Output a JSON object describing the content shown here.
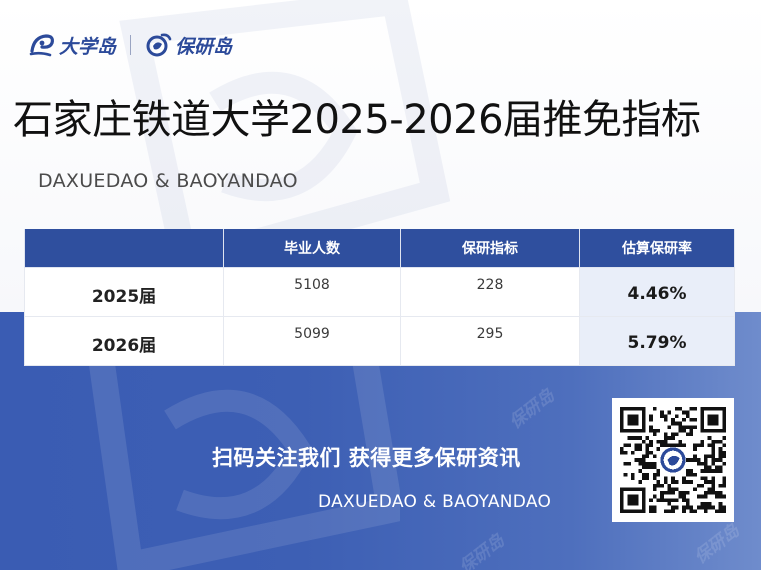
{
  "brand": {
    "logo1_text": "大学岛",
    "logo2_text": "保研岛",
    "brand_color": "#2c4a9a",
    "watermark_text": "保研岛"
  },
  "header": {
    "title": "石家庄铁道大学2025-2026届推免指标",
    "subtitle": "DAXUEDAO & BAOYANDAO"
  },
  "table": {
    "header_color": "#2f4f9e",
    "columns": [
      "",
      "毕业人数",
      "保研指标",
      "估算保研率"
    ],
    "rows": [
      {
        "year": "2025届",
        "graduates": "5108",
        "quota": "228",
        "rate": "4.46%"
      },
      {
        "year": "2026届",
        "graduates": "5099",
        "quota": "295",
        "rate": "5.79%"
      }
    ]
  },
  "footer": {
    "cta": "扫码关注我们 获得更多保研资讯",
    "cta_sub": "DAXUEDAO & BAOYANDAO",
    "background_color": "#3d5fb4",
    "qr_icon": "qr-code-icon"
  }
}
